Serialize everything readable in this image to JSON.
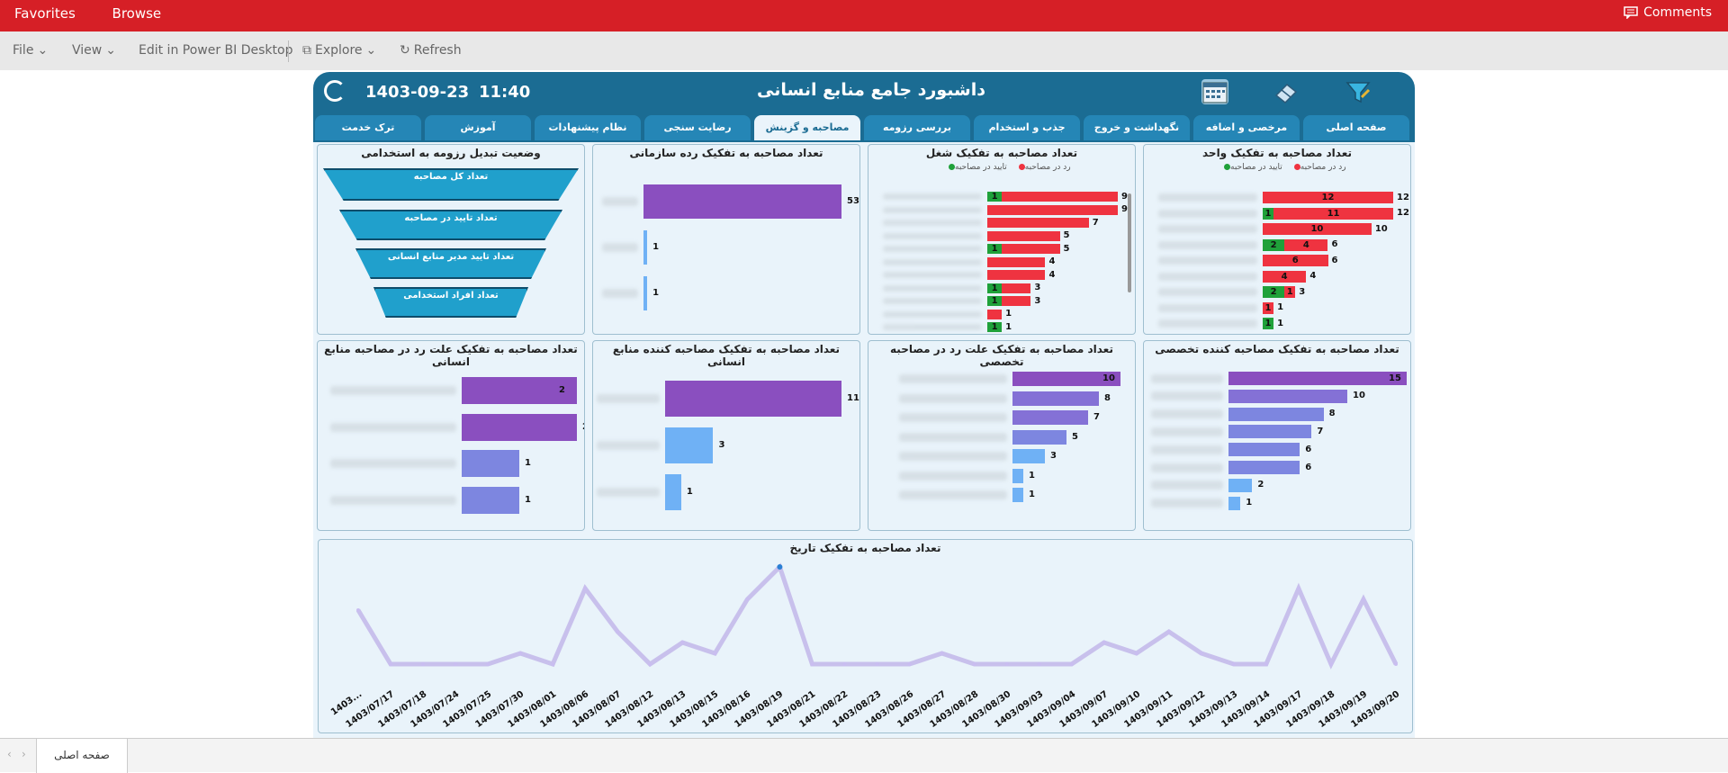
{
  "app": {
    "nav": [
      "Favorites",
      "Browse"
    ],
    "comments_label": "Comments",
    "toolbar": {
      "file": "File",
      "view": "View",
      "edit_desktop": "Edit in Power BI Desktop",
      "explore": "Explore",
      "refresh": "Refresh"
    },
    "page_tab": "صفحه اصلی"
  },
  "report": {
    "title": "داشبورد جامع منابع انسانی",
    "date": "1403-09-23",
    "time": "11:40",
    "tabs": [
      {
        "label": "صفحه اصلی"
      },
      {
        "label": "مرخصی و اضافه کاری"
      },
      {
        "label": "نگهداشت و خروج"
      },
      {
        "label": "جذب و استخدام"
      },
      {
        "label": "بررسی رزومه"
      },
      {
        "label": "مصاحبه و گزینش"
      },
      {
        "label": "رضایت سنجی"
      },
      {
        "label": "نظام پیشنهادات"
      },
      {
        "label": "آموزش"
      },
      {
        "label": "ترک خدمت"
      }
    ],
    "active_tab": "مصاحبه و گزینش",
    "colors": {
      "header": "#1b6c93",
      "reject": "#ef3340",
      "approve": "#1fa13a",
      "purple": "#8a4fbf",
      "blue_light": "#6fb1f5"
    },
    "legend": {
      "reject": "رد در مصاحبه",
      "approve": "تایید در مصاحبه"
    }
  },
  "chart_data": [
    {
      "id": "by_unit",
      "type": "bar",
      "title": "تعداد مصاحبه به تفکیک واحد",
      "series": [
        {
          "name": "تایید در مصاحبه",
          "values": [
            0,
            1,
            0,
            2,
            0,
            0,
            2,
            0,
            1
          ]
        },
        {
          "name": "رد در مصاحبه",
          "values": [
            12,
            11,
            10,
            4,
            6,
            4,
            1,
            1,
            0
          ]
        }
      ],
      "totals": [
        12,
        12,
        10,
        6,
        6,
        4,
        3,
        1,
        1
      ]
    },
    {
      "id": "by_job",
      "type": "bar",
      "title": "تعداد مصاحبه به تفکیک شغل",
      "series": [
        {
          "name": "تایید در مصاحبه",
          "values": [
            1,
            0,
            0,
            0,
            1,
            0,
            0,
            1,
            1,
            0,
            1
          ]
        },
        {
          "name": "رد در مصاحبه",
          "values": [
            8,
            9,
            7,
            5,
            4,
            4,
            4,
            2,
            2,
            1,
            0
          ]
        }
      ],
      "totals": [
        9,
        9,
        7,
        5,
        5,
        4,
        4,
        3,
        3,
        1,
        1
      ]
    },
    {
      "id": "by_rank",
      "type": "bar",
      "title": "تعداد مصاحبه به تفکیک رده سازمانی",
      "values": [
        53,
        1,
        1
      ]
    },
    {
      "id": "funnel",
      "type": "funnel",
      "title": "وضعیت تبدیل رزومه به استخدامی",
      "stages": [
        "تعداد کل مصاحبه",
        "تعداد تایید در مصاحبه",
        "تعداد تایید مدیر منابع انسانی",
        "تعداد افراد استخدامی"
      ]
    },
    {
      "id": "by_specialist",
      "type": "bar",
      "title": "تعداد مصاحبه به تفکیک مصاحبه کننده تخصصی",
      "values": [
        15,
        10,
        8,
        7,
        6,
        6,
        2,
        1
      ]
    },
    {
      "id": "by_specialist_reason",
      "type": "bar",
      "title": "تعداد مصاحبه به تفکیک علت رد در مصاحبه تخصصی",
      "values": [
        10,
        8,
        7,
        5,
        3,
        1,
        1
      ]
    },
    {
      "id": "by_hr_interviewer",
      "type": "bar",
      "title": "تعداد مصاحبه به تفکیک مصاحبه کننده منابع انسانی",
      "values": [
        11,
        3,
        1
      ]
    },
    {
      "id": "by_hr_reason",
      "type": "bar",
      "title": "تعداد مصاحبه به تفکیک علت رد در مصاحبه منابع انسانی",
      "values": [
        2,
        2,
        1,
        1
      ]
    },
    {
      "id": "by_date",
      "type": "line",
      "title": "تعداد مصاحبه به تفکیک تاریخ",
      "x": [
        "1403...",
        "1403/07/17",
        "1403/07/18",
        "1403/07/24",
        "1403/07/25",
        "1403/07/30",
        "1403/08/01",
        "1403/08/06",
        "1403/08/07",
        "1403/08/12",
        "1403/08/13",
        "1403/08/15",
        "1403/08/16",
        "1403/08/19",
        "1403/08/21",
        "1403/08/22",
        "1403/08/23",
        "1403/08/26",
        "1403/08/27",
        "1403/08/28",
        "1403/08/30",
        "1403/09/03",
        "1403/09/04",
        "1403/09/07",
        "1403/09/10",
        "1403/09/11",
        "1403/09/12",
        "1403/09/13",
        "1403/09/14",
        "1403/09/17",
        "1403/09/18",
        "1403/09/19",
        "1403/09/20"
      ],
      "values": [
        6,
        1,
        1,
        1,
        1,
        2,
        1,
        8,
        4,
        1,
        3,
        2,
        7,
        10,
        1,
        1,
        1,
        1,
        2,
        1,
        1,
        1,
        1,
        3,
        2,
        4,
        2,
        1,
        1,
        8,
        1,
        7,
        1
      ]
    }
  ]
}
